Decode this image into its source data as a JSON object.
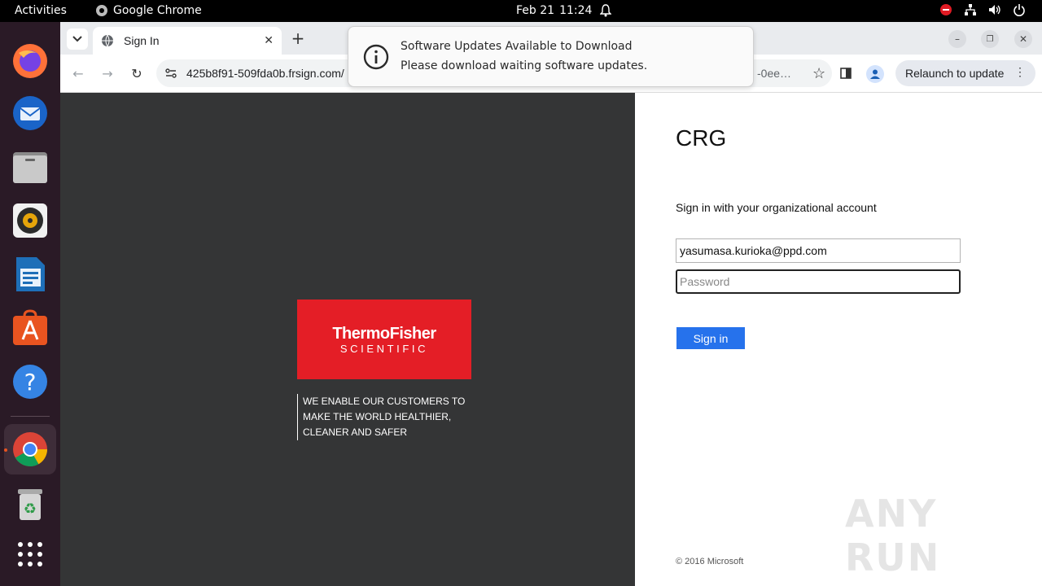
{
  "topbar": {
    "activities": "Activities",
    "app_name": "Google Chrome",
    "date": "Feb 21",
    "time": "11:24"
  },
  "browser": {
    "tab_title": "Sign In",
    "url": "425b8f91-509fda0b.frsign.com/",
    "url_tail": "-0ee…",
    "relaunch_label": "Relaunch to update"
  },
  "notification": {
    "title": "Software Updates Available to Download",
    "body": "Please download waiting software updates."
  },
  "brand": {
    "logo_main": "ThermoFisher",
    "logo_sub": "SCIENTIFIC",
    "tagline_1": "WE ENABLE OUR CUSTOMERS TO",
    "tagline_2": "MAKE THE WORLD HEALTHIER,",
    "tagline_3": "CLEANER AND SAFER",
    "color": "#e41e26"
  },
  "signin": {
    "org": "CRG",
    "prompt": "Sign in with your organizational account",
    "email_value": "yasumasa.kurioka@ppd.com",
    "password_placeholder": "Password",
    "button_label": "Sign in",
    "copyright": "© 2016 Microsoft",
    "button_color": "#2672ec"
  },
  "watermark": "ANY RUN"
}
